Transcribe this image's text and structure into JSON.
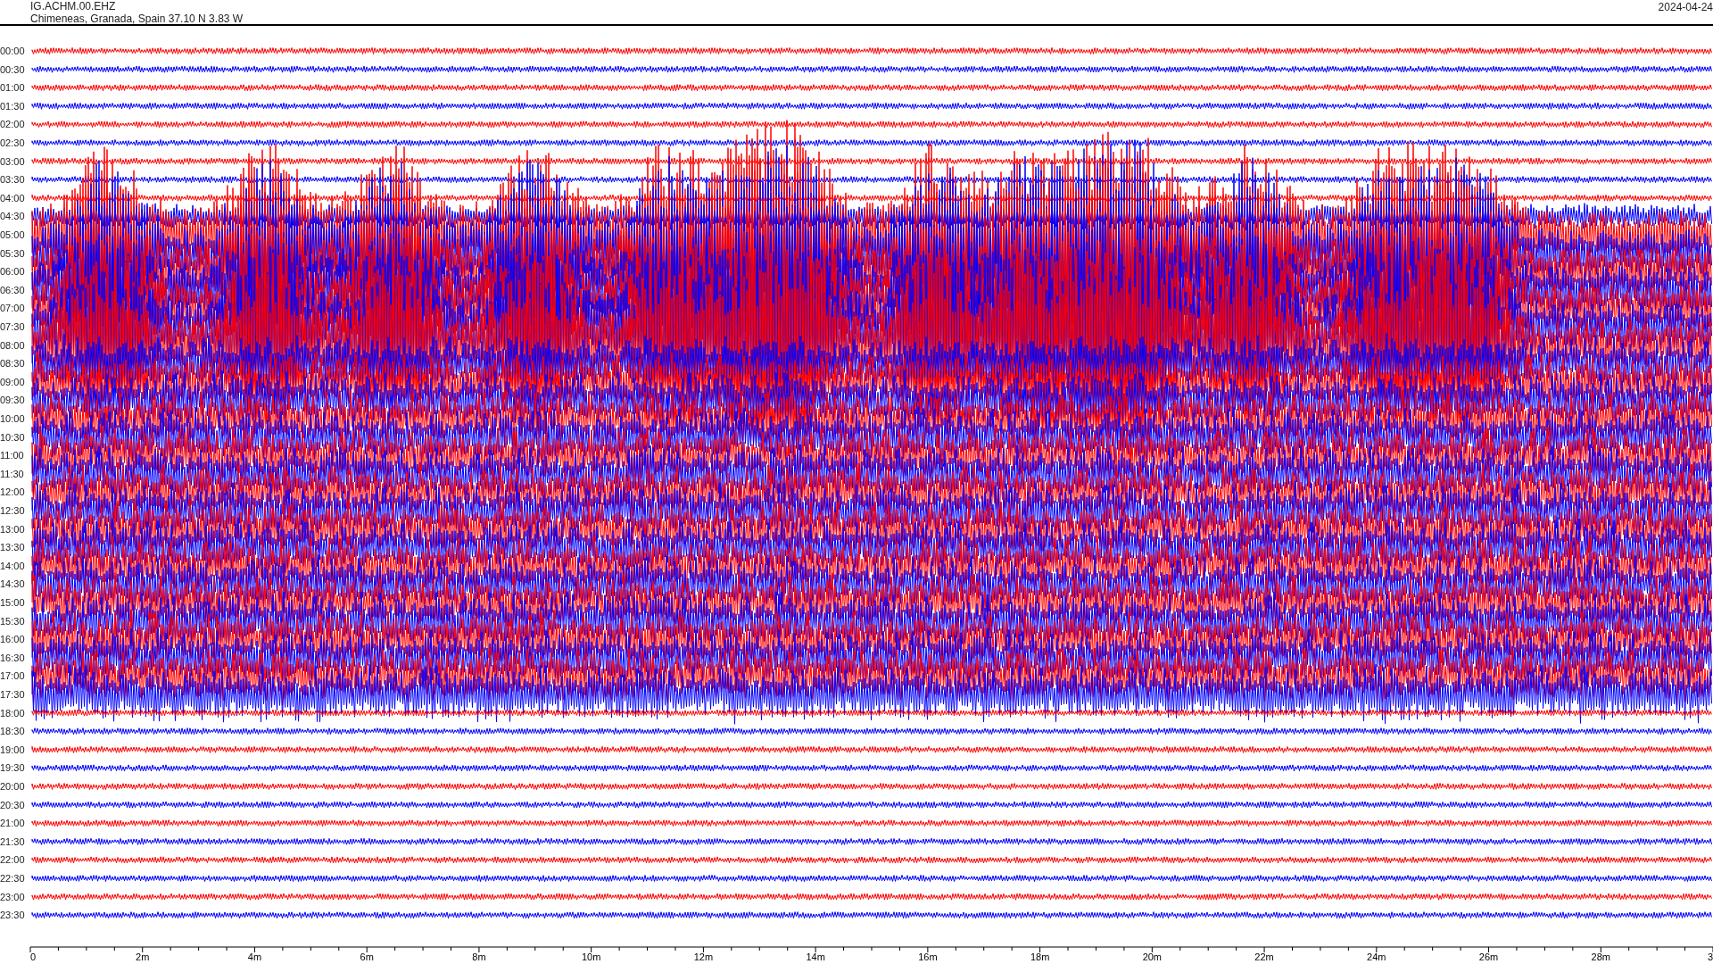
{
  "header": {
    "station": "IG.ACHM.00.EHZ",
    "location": "Chimeneas, Granada, Spain  37.10 N 3.83 W",
    "date": "2024-04-24"
  },
  "rows": [
    "00:00",
    "00:30",
    "01:00",
    "01:30",
    "02:00",
    "02:30",
    "03:00",
    "03:30",
    "04:00",
    "04:30",
    "05:00",
    "05:30",
    "06:00",
    "06:30",
    "07:00",
    "07:30",
    "08:00",
    "08:30",
    "09:00",
    "09:30",
    "10:00",
    "10:30",
    "11:00",
    "11:30",
    "12:00",
    "12:30",
    "13:00",
    "13:30",
    "14:00",
    "14:30",
    "15:00",
    "15:30",
    "16:00",
    "16:30",
    "17:00",
    "17:30",
    "18:00",
    "18:30",
    "19:00",
    "19:30",
    "20:00",
    "20:30",
    "21:00",
    "21:30",
    "22:00",
    "22:30",
    "23:00",
    "23:30"
  ],
  "x_axis": {
    "tick_labels": [
      "0",
      "2m",
      "4m",
      "6m",
      "8m",
      "10m",
      "12m",
      "14m",
      "16m",
      "18m",
      "20m",
      "22m",
      "24m",
      "26m",
      "28m",
      "3"
    ]
  }
}
